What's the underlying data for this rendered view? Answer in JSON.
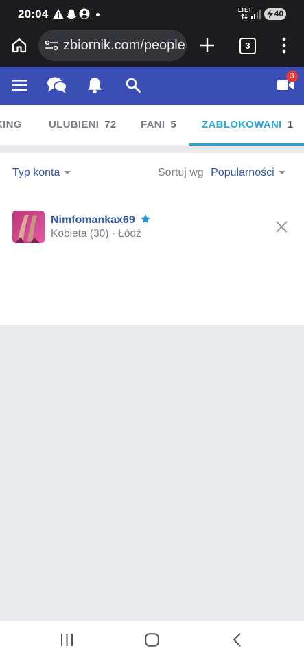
{
  "status_bar": {
    "time": "20:04",
    "network": "LTE+",
    "battery": "40",
    "icons": [
      "warning-icon",
      "snapchat-icon",
      "account-circle-icon"
    ]
  },
  "browser": {
    "url": "zbiornik.com/people",
    "tab_count": "3",
    "icons": [
      "home-icon",
      "site-settings-icon",
      "new-tab-icon",
      "menu-dots-icon"
    ]
  },
  "site_header": {
    "icons": [
      "hamburger-menu-icon",
      "chat-icon",
      "bell-icon",
      "search-icon",
      "video-camera-icon"
    ],
    "video_badge": "3",
    "accent_color": "#3a4eb5"
  },
  "tabs": [
    {
      "label": "KING",
      "count": ""
    },
    {
      "label": "ULUBIENI",
      "count": "72"
    },
    {
      "label": "FANI",
      "count": "5"
    },
    {
      "label": "ZABLOKOWANI",
      "count": "1",
      "active": true
    }
  ],
  "filters": {
    "account_type": "Typ konta",
    "sort_label": "Sortuj wg",
    "sort_value": "Popularności"
  },
  "users": [
    {
      "name": "Nimfomankax69",
      "info": "Kobieta (30) · Łódź",
      "verified_icon": "star-icon",
      "remove_icon": "close-icon"
    }
  ],
  "nav": {
    "icons": [
      "recent-apps-icon",
      "home-circle-icon",
      "back-icon"
    ]
  }
}
